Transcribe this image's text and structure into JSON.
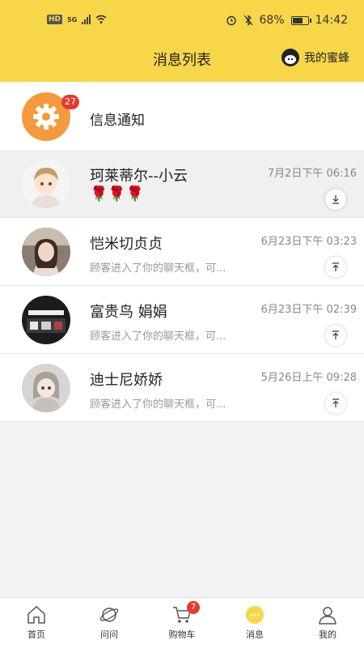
{
  "status_bar": {
    "hd": "HD",
    "network": "5G",
    "battery": "68%",
    "time": "14:42"
  },
  "header": {
    "title": "消息列表",
    "my_bee": "我的蜜蜂"
  },
  "notification": {
    "title": "信息通知",
    "badge": "27"
  },
  "conversations": [
    {
      "name": "珂莱蒂尔--小云",
      "time": "7月2日下午 06:16",
      "preview": "🌹🌹🌹",
      "action": "download"
    },
    {
      "name": "恺米切贞贞",
      "time": "6月23日下午 03:23",
      "preview": "顾客进入了你的聊天框，可...",
      "action": "pin-top"
    },
    {
      "name": "富贵鸟 娟娟",
      "time": "6月23日下午 02:39",
      "preview": "顾客进入了你的聊天框，可...",
      "action": "pin-top"
    },
    {
      "name": "迪士尼娇娇",
      "time": "5月26日上午 09:28",
      "preview": "顾客进入了你的聊天框，可...",
      "action": "pin-top"
    }
  ],
  "tabbar": {
    "items": [
      {
        "label": "首页",
        "icon": "home-icon"
      },
      {
        "label": "问问",
        "icon": "planet-icon"
      },
      {
        "label": "购物车",
        "icon": "cart-icon",
        "badge": "7"
      },
      {
        "label": "消息",
        "icon": "chat-bubble-icon",
        "active": true
      },
      {
        "label": "我的",
        "icon": "user-icon"
      }
    ]
  },
  "colors": {
    "brand_yellow": "#f7d64a",
    "badge_red": "#e53a2f",
    "notify_orange": "#f39a3e"
  }
}
